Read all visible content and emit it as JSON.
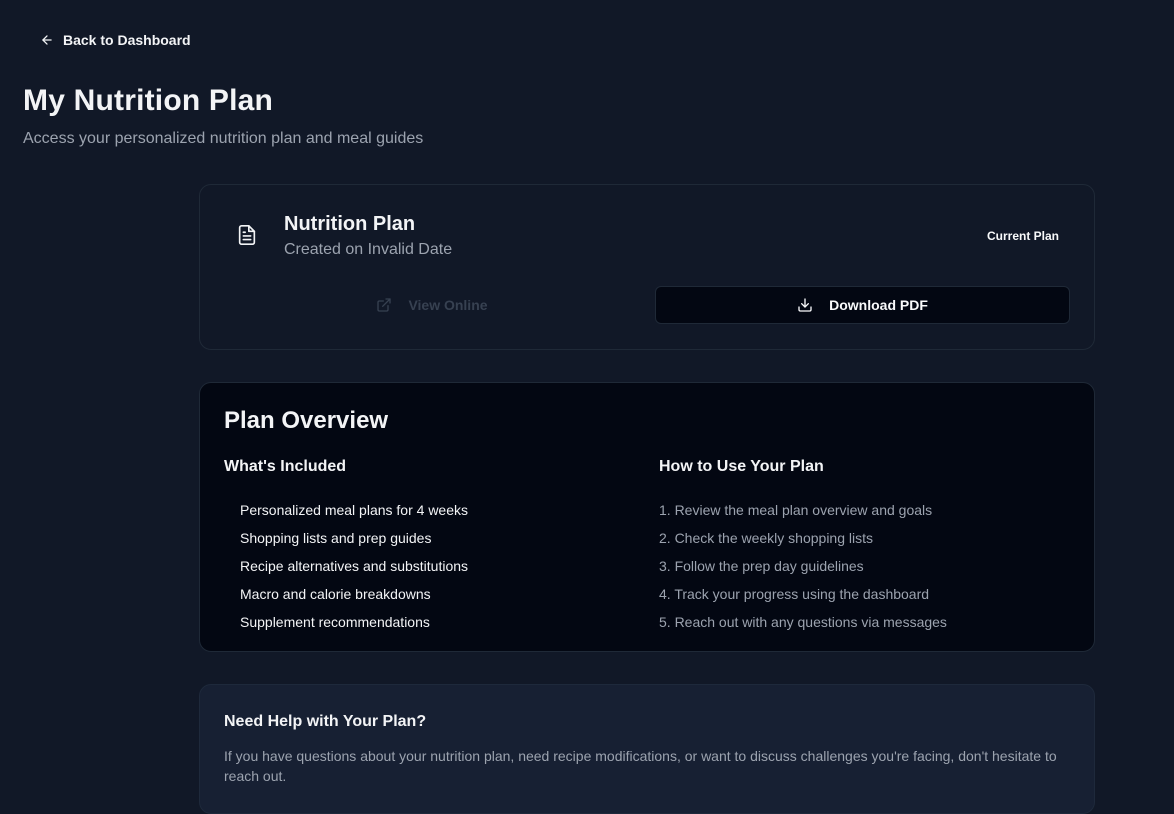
{
  "nav": {
    "back_label": "Back to Dashboard"
  },
  "header": {
    "title": "My Nutrition Plan",
    "subtitle": "Access your personalized nutrition plan and meal guides"
  },
  "plan": {
    "title": "Nutrition Plan",
    "created": "Created on Invalid Date",
    "badge": "Current Plan",
    "view_online_label": "View Online",
    "download_label": "Download PDF"
  },
  "overview": {
    "title": "Plan Overview",
    "included_heading": "What's Included",
    "included": [
      "Personalized meal plans for 4 weeks",
      "Shopping lists and prep guides",
      "Recipe alternatives and substitutions",
      "Macro and calorie breakdowns",
      "Supplement recommendations"
    ],
    "howto_heading": "How to Use Your Plan",
    "howto": [
      "1. Review the meal plan overview and goals",
      "2. Check the weekly shopping lists",
      "3. Follow the prep day guidelines",
      "4. Track your progress using the dashboard",
      "5. Reach out with any questions via messages"
    ]
  },
  "help": {
    "title": "Need Help with Your Plan?",
    "text": "If you have questions about your nutrition plan, need recipe modifications, or want to discuss challenges you're facing, don't hesitate to reach out."
  },
  "icons": {
    "back": "arrow-left-icon",
    "plan": "file-text-icon",
    "view_online": "external-link-icon",
    "download": "download-icon"
  },
  "colors": {
    "background": "#111827",
    "card_dark": "#030712",
    "help_bg": "#172033",
    "muted_text": "#9ca3af"
  }
}
